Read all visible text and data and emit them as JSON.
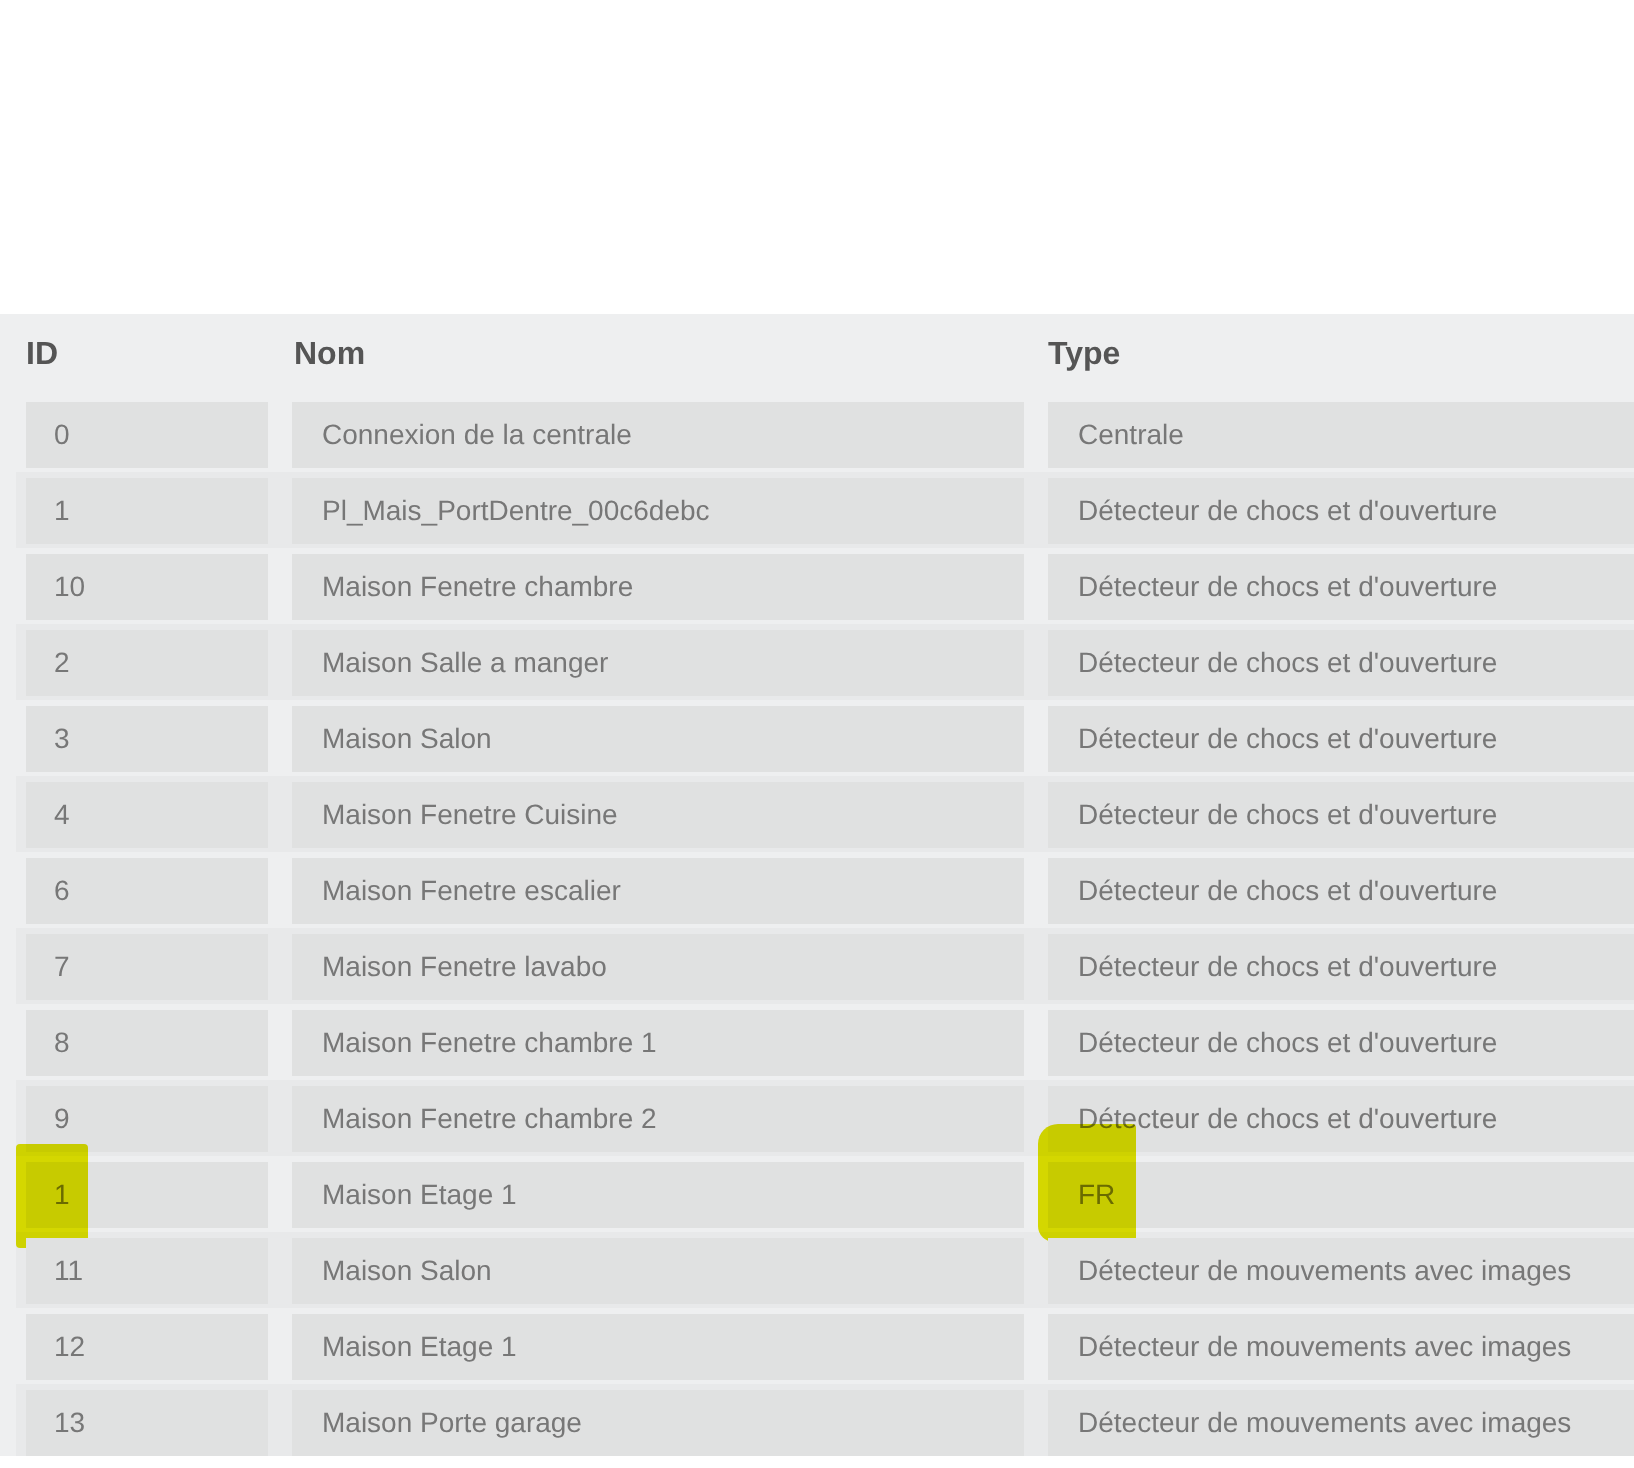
{
  "table": {
    "columns": [
      "ID",
      "Nom",
      "Type"
    ],
    "rows": [
      {
        "id": "0",
        "nom": "Connexion de la centrale",
        "type": "Centrale",
        "highlighted": false
      },
      {
        "id": "1",
        "nom": "Pl_Mais_PortDentre_00c6debc",
        "type": "Détecteur de chocs et d'ouverture",
        "highlighted": false
      },
      {
        "id": "10",
        "nom": "Maison Fenetre chambre",
        "type": "Détecteur de chocs et d'ouverture",
        "highlighted": false
      },
      {
        "id": "2",
        "nom": "Maison Salle a manger",
        "type": "Détecteur de chocs et d'ouverture",
        "highlighted": false
      },
      {
        "id": "3",
        "nom": "Maison Salon",
        "type": "Détecteur de chocs et d'ouverture",
        "highlighted": false
      },
      {
        "id": "4",
        "nom": "Maison Fenetre Cuisine",
        "type": "Détecteur de chocs et d'ouverture",
        "highlighted": false
      },
      {
        "id": "6",
        "nom": "Maison Fenetre escalier",
        "type": "Détecteur de chocs et d'ouverture",
        "highlighted": false
      },
      {
        "id": "7",
        "nom": "Maison Fenetre lavabo",
        "type": "Détecteur de chocs et d'ouverture",
        "highlighted": false
      },
      {
        "id": "8",
        "nom": "Maison Fenetre chambre 1",
        "type": "Détecteur de chocs et d'ouverture",
        "highlighted": false
      },
      {
        "id": "9",
        "nom": "Maison Fenetre chambre 2",
        "type": "Détecteur de chocs et d'ouverture",
        "highlighted": false
      },
      {
        "id": "1",
        "nom": "Maison Etage 1",
        "type": "FR",
        "highlighted": true
      },
      {
        "id": "11",
        "nom": "Maison Salon",
        "type": "Détecteur de mouvements avec images",
        "highlighted": false
      },
      {
        "id": "12",
        "nom": "Maison Etage 1",
        "type": "Détecteur de mouvements avec images",
        "highlighted": false
      },
      {
        "id": "13",
        "nom": "Maison Porte garage",
        "type": "Détecteur de mouvements avec images",
        "highlighted": false
      }
    ]
  }
}
